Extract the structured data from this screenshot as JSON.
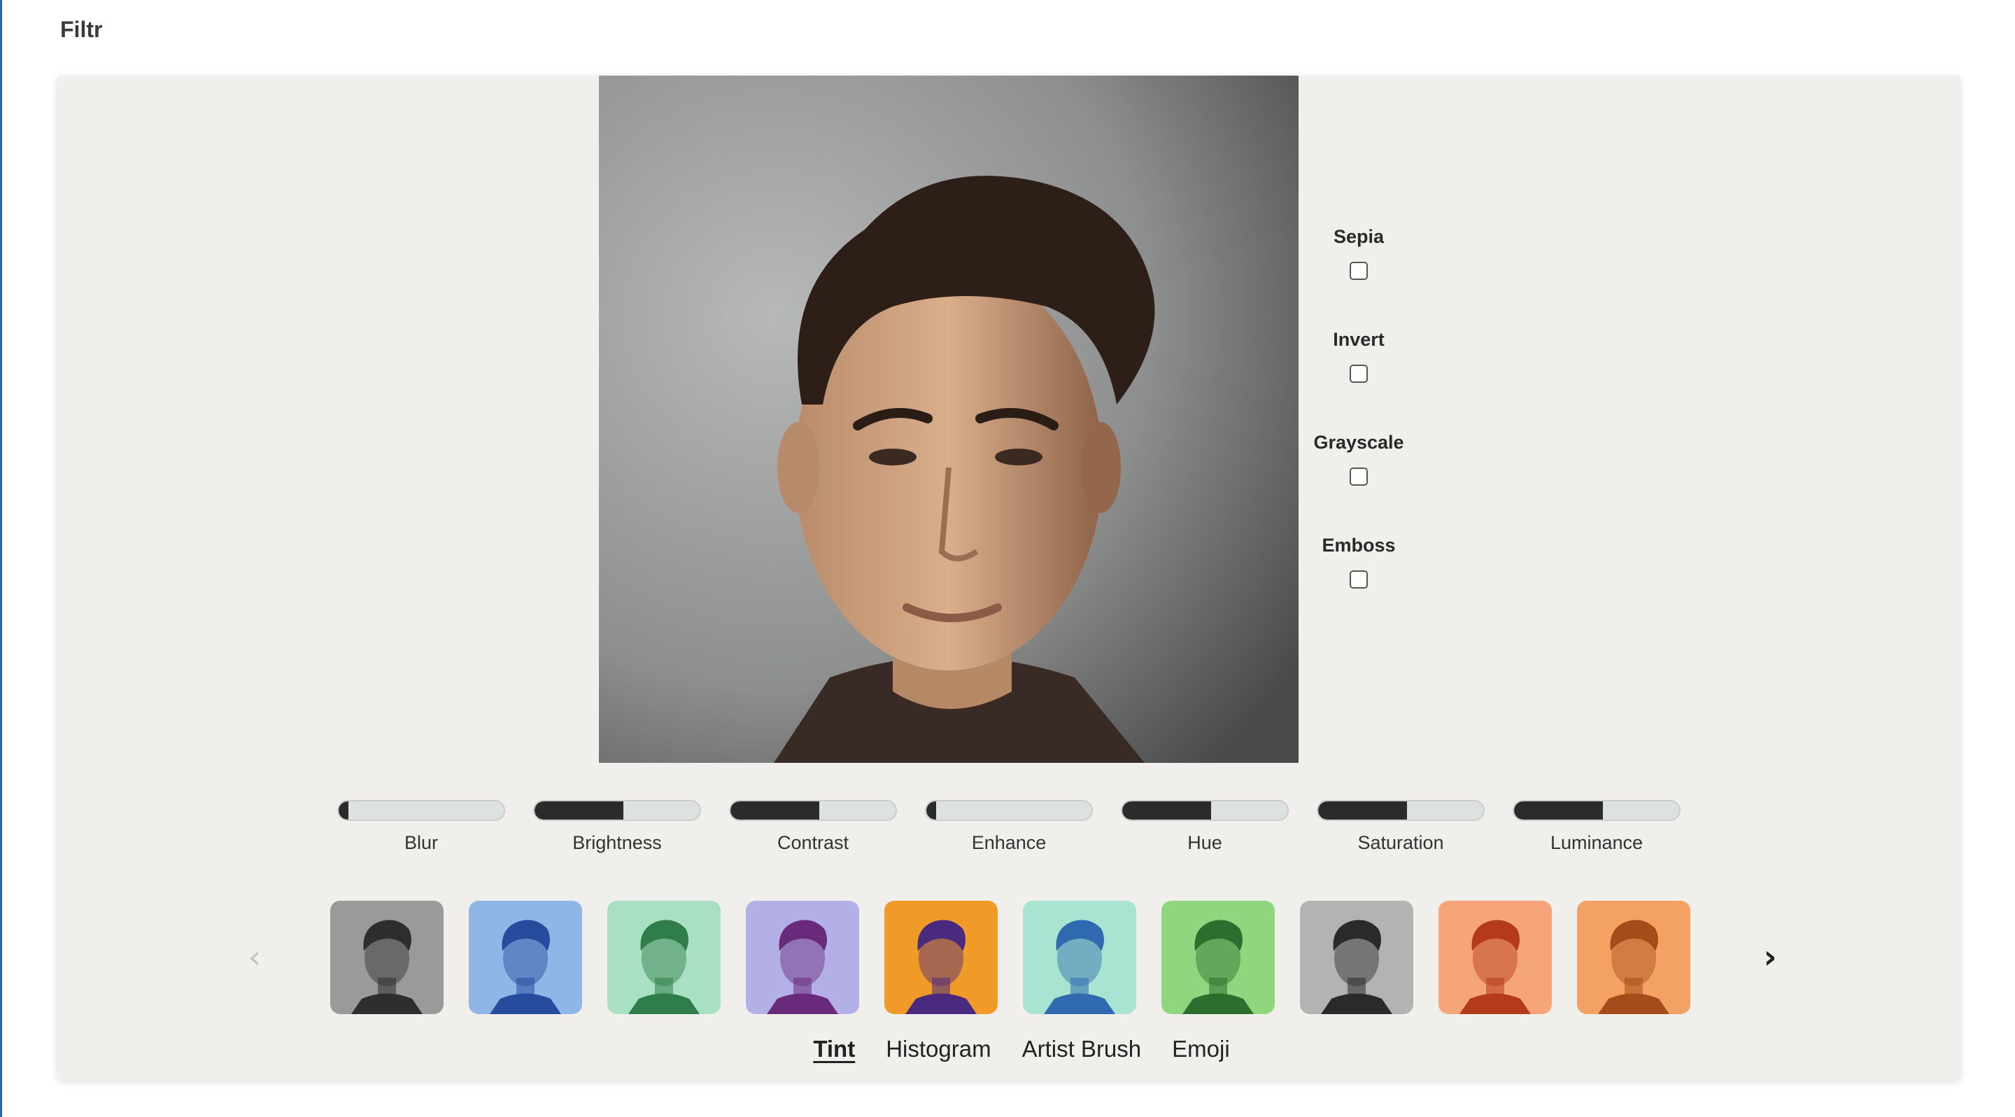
{
  "app": {
    "title": "Filtr"
  },
  "toggles": [
    {
      "label": "Sepia",
      "checked": false
    },
    {
      "label": "Invert",
      "checked": false
    },
    {
      "label": "Grayscale",
      "checked": false
    },
    {
      "label": "Emboss",
      "checked": false
    }
  ],
  "sliders": [
    {
      "label": "Blur",
      "value": 0.06
    },
    {
      "label": "Brightness",
      "value": 0.54
    },
    {
      "label": "Contrast",
      "value": 0.54
    },
    {
      "label": "Enhance",
      "value": 0.06
    },
    {
      "label": "Hue",
      "value": 0.54
    },
    {
      "label": "Saturation",
      "value": 0.54
    },
    {
      "label": "Luminance",
      "value": 0.54
    }
  ],
  "carousel": {
    "prev_icon": "chevron-left-icon",
    "next_icon": "chevron-right-icon",
    "thumbnails": [
      {
        "name": "grayscale",
        "bg": "#9a9a9a",
        "fg": "#2e2e2e"
      },
      {
        "name": "blue",
        "bg": "#8fb6e6",
        "fg": "#274c9e"
      },
      {
        "name": "mint",
        "bg": "#a9dfc2",
        "fg": "#2f7d4a"
      },
      {
        "name": "violet",
        "bg": "#b2b0e6",
        "fg": "#6a2a7c"
      },
      {
        "name": "sunset",
        "bg": "#f09a28",
        "fg": "#4a2a7e"
      },
      {
        "name": "aqua",
        "bg": "#a9e4d2",
        "fg": "#2f6ab0"
      },
      {
        "name": "green",
        "bg": "#8fd67f",
        "fg": "#2c6e2e"
      },
      {
        "name": "mono",
        "bg": "#b3b3b3",
        "fg": "#2a2a2a"
      },
      {
        "name": "red-orange",
        "bg": "#f6a57a",
        "fg": "#b43a1c"
      },
      {
        "name": "orange",
        "bg": "#f4a263",
        "fg": "#a54d1a"
      }
    ]
  },
  "tabs": [
    {
      "label": "Tint",
      "active": true
    },
    {
      "label": "Histogram",
      "active": false
    },
    {
      "label": "Artist Brush",
      "active": false
    },
    {
      "label": "Emoji",
      "active": false
    }
  ],
  "colors": {
    "panel": "#f0efeb",
    "slider_fill": "#2b2b2b",
    "slider_track": "#dde2e0"
  }
}
